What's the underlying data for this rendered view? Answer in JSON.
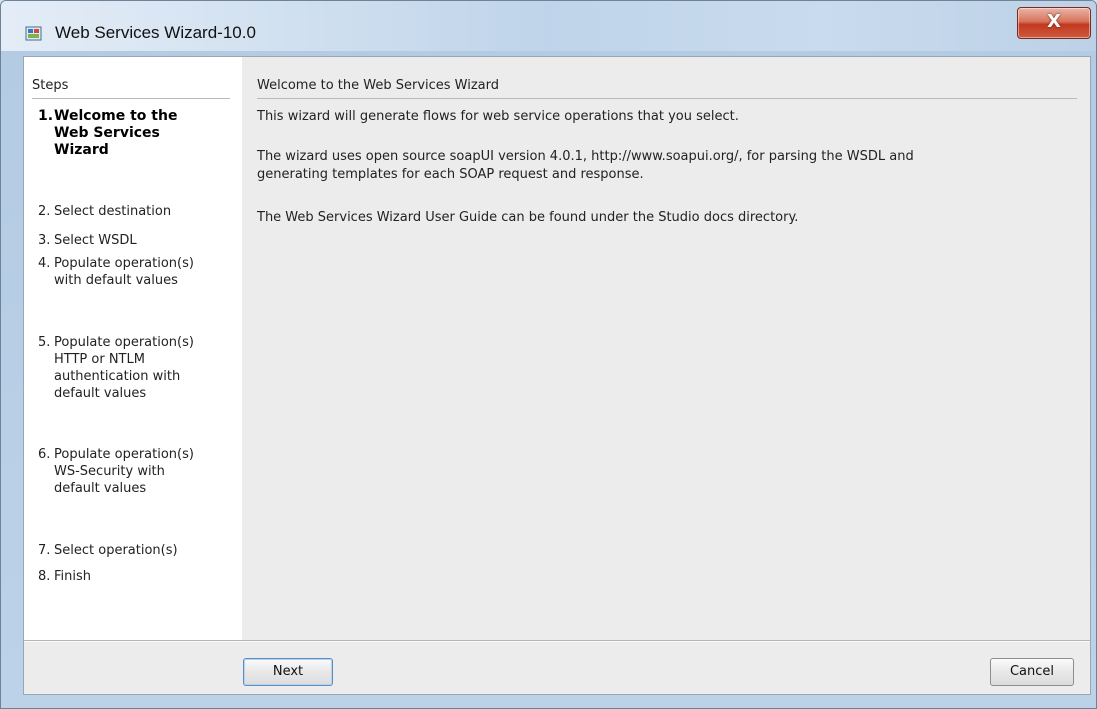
{
  "window": {
    "title": "Web Services Wizard-10.0",
    "close_label": "X"
  },
  "steps": {
    "header": "Steps",
    "items": [
      {
        "num": "1.",
        "lines": [
          "Welcome to the",
          "Web Services",
          "Wizard"
        ],
        "active": true
      },
      {
        "num": "2.",
        "lines": [
          "Select destination"
        ],
        "active": false
      },
      {
        "num": "3.",
        "lines": [
          "Select WSDL"
        ],
        "active": false
      },
      {
        "num": "4.",
        "lines": [
          "Populate operation(s)",
          "with default values"
        ],
        "active": false
      },
      {
        "num": "5.",
        "lines": [
          "Populate operation(s)",
          "HTTP or NTLM",
          "authentication with",
          "default values"
        ],
        "active": false
      },
      {
        "num": "6.",
        "lines": [
          "Populate operation(s)",
          "WS-Security with",
          "default values"
        ],
        "active": false
      },
      {
        "num": "7.",
        "lines": [
          "Select operation(s)"
        ],
        "active": false
      },
      {
        "num": "8.",
        "lines": [
          "Finish"
        ],
        "active": false
      }
    ]
  },
  "content": {
    "title": "Welcome to the Web Services Wizard",
    "paragraphs": [
      [
        "This wizard will generate flows for web service operations that you select."
      ],
      [
        "The wizard uses open source soapUI version 4.0.1, http://www.soapui.org/, for parsing the WSDL and",
        "generating templates for each SOAP request and response."
      ],
      [
        "The Web Services Wizard User Guide can be found under the Studio docs directory."
      ]
    ]
  },
  "buttons": {
    "next": "Next",
    "cancel": "Cancel"
  }
}
